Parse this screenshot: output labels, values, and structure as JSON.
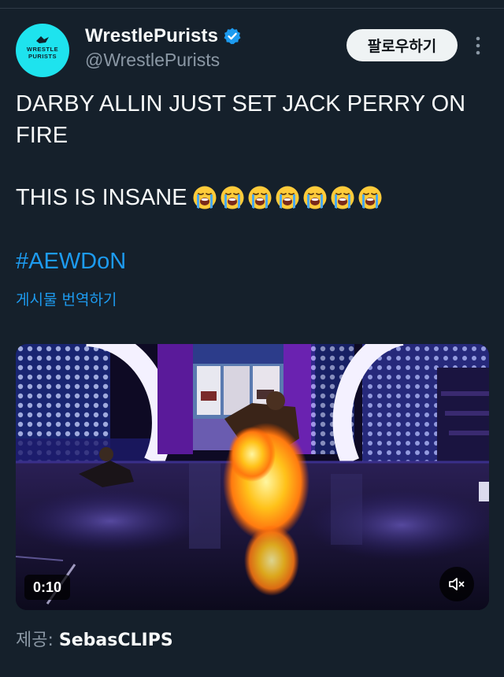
{
  "author": {
    "display_name": "WrestlePurists",
    "handle": "@WrestlePurists",
    "verified": true,
    "avatar_text_top": "WRESTLE",
    "avatar_text_bottom": "PURISTS",
    "avatar_color": "#1ee3ee"
  },
  "actions": {
    "follow_label": "팔로우하기",
    "more_icon": "more-vertical-icon"
  },
  "tweet": {
    "line1": "DARBY ALLIN JUST SET JACK PERRY ON",
    "line2": "FIRE",
    "line3": "THIS IS INSANE",
    "emoji": "loudly-crying-face",
    "emoji_count": 7,
    "hashtag": "#AEWDoN",
    "translate_label": "게시물 번역하기"
  },
  "media": {
    "type": "video",
    "timestamp": "0:10",
    "mute_icon": "speaker-muted-icon",
    "credit_label": "제공:",
    "credit_name": "SebasCLIPS"
  },
  "colors": {
    "background": "#15202b",
    "text": "#f7f9f9",
    "secondary_text": "#8b98a5",
    "link": "#1d9bf0",
    "verified": "#1d9bf0"
  }
}
